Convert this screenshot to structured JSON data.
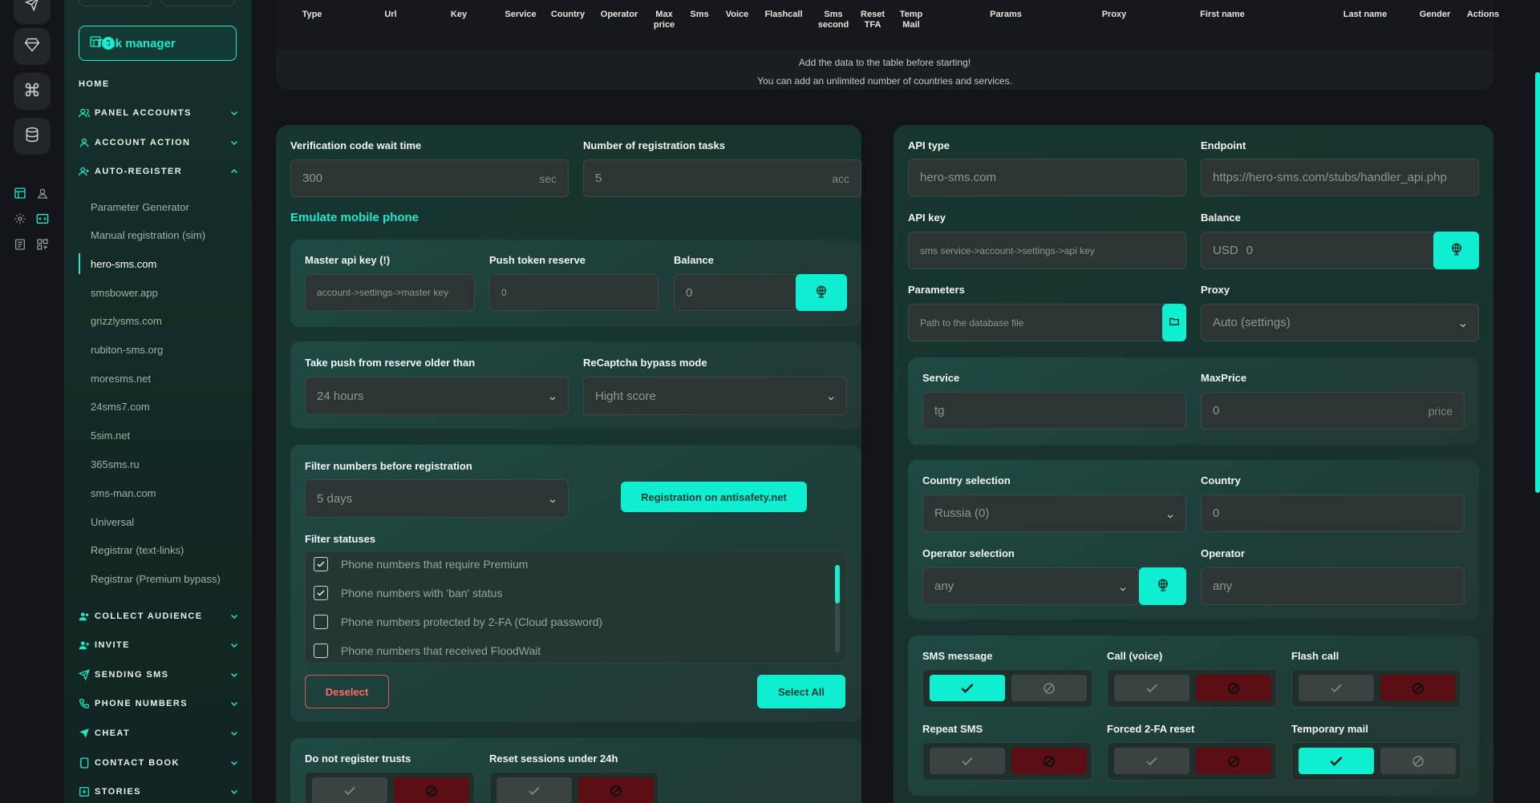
{
  "sidebar": {
    "task_manager": {
      "label": "Task manager",
      "count": "0"
    },
    "home": "HOME",
    "sections": [
      {
        "label": "PANEL ACCOUNTS",
        "icon": "users-icon"
      },
      {
        "label": "ACCOUNT ACTION",
        "icon": "user-icon"
      },
      {
        "label": "AUTO-REGISTER",
        "icon": "user-plus-icon"
      }
    ],
    "auto_register_items": [
      "Parameter Generator",
      "Manual registration (sim)",
      "hero-sms.com",
      "smsbower.app",
      "grizzlysms.com",
      "rubiton-sms.org",
      "moresms.net",
      "24sms7.com",
      "5sim.net",
      "365sms.ru",
      "sms-man.com",
      "Universal",
      "Registrar (text-links)",
      "Registrar (Premium bypass)"
    ],
    "lower_sections": [
      {
        "label": "COLLECT AUDIENCE",
        "icon": "users-icon"
      },
      {
        "label": "INVITE",
        "icon": "user-add-icon"
      },
      {
        "label": "SENDING SMS",
        "icon": "send-icon"
      },
      {
        "label": "PHONE NUMBERS",
        "icon": "phone-icon"
      },
      {
        "label": "CHEAT",
        "icon": "send-icon"
      },
      {
        "label": "CONTACT BOOK",
        "icon": "book-icon"
      },
      {
        "label": "STORIES",
        "icon": "plus-square-icon"
      }
    ]
  },
  "table": {
    "headers": [
      "Type",
      "Url",
      "Key",
      "Service",
      "Country",
      "Operator",
      "Max price",
      "Sms",
      "Voice",
      "Flashcall",
      "Sms second",
      "Reset TFA",
      "Temp Mail",
      "Params",
      "Proxy",
      "First name",
      "Last name",
      "Gender",
      "Actions"
    ],
    "note_1": "Add the data to the table before starting!",
    "note_2": "You can add an unlimited number of countries and services."
  },
  "left": {
    "verif_label": "Verification code wait time",
    "verif_value": "300",
    "verif_suffix": "sec",
    "tasks_label": "Number of registration tasks",
    "tasks_value": "5",
    "tasks_suffix": "acc",
    "emulate": "Emulate mobile phone",
    "master_label": "Master api key (!)",
    "master_placeholder": "account->settings->master key",
    "push_label": "Push token reserve",
    "push_value": "0",
    "balance_label": "Balance",
    "balance_value": "0",
    "older_label": "Take push from reserve older than",
    "older_value": "24 hours",
    "recaptcha_label": "ReCaptcha bypass mode",
    "recaptcha_value": "Hight score",
    "filter_label": "Filter numbers before registration",
    "filter_value": "5 days",
    "antisafety_button": "Registration on antisafety.net",
    "statuses_label": "Filter statuses",
    "statuses": [
      {
        "label": "Phone numbers that require Premium",
        "checked": true
      },
      {
        "label": "Phone numbers with 'ban' status",
        "checked": true
      },
      {
        "label": "Phone numbers protected by 2-FA (Cloud password)",
        "checked": false
      },
      {
        "label": "Phone numbers that received FloodWait",
        "checked": false
      }
    ],
    "deselect": "Deselect",
    "select_all": "Select All",
    "trusts_label": "Do not register trusts",
    "reset_label": "Reset sessions under 24h"
  },
  "right": {
    "api_type_label": "API type",
    "api_type_value": "hero-sms.com",
    "endpoint_label": "Endpoint",
    "endpoint_value": "https://hero-sms.com/stubs/handler_api.php",
    "api_key_label": "API key",
    "api_key_placeholder": "sms service->account->settings->api key",
    "balance_label": "Balance",
    "balance_currency": "USD",
    "balance_value": "0",
    "params_label": "Parameters",
    "params_placeholder": "Path to the database file",
    "proxy_label": "Proxy",
    "proxy_value": "Auto (settings)",
    "service_label": "Service",
    "service_value": "tg",
    "maxprice_label": "MaxPrice",
    "maxprice_value": "0",
    "maxprice_suffix": "price",
    "country_sel_label": "Country selection",
    "country_sel_value": "Russia (0)",
    "country_label": "Country",
    "country_value": "0",
    "operator_sel_label": "Operator selection",
    "operator_sel_value": "any",
    "operator_label": "Operator",
    "operator_value": "any",
    "toggles": [
      {
        "label": "SMS message",
        "on": true
      },
      {
        "label": "Call (voice)",
        "on": false
      },
      {
        "label": "Flash call",
        "on": false
      },
      {
        "label": "Repeat SMS",
        "on": false
      },
      {
        "label": "Forced 2-FA reset",
        "on": false
      },
      {
        "label": "Temporary mail",
        "on": true
      }
    ]
  },
  "colors": {
    "accent": "#10eed2",
    "danger": "#5b0f14",
    "bg": "#121417"
  }
}
